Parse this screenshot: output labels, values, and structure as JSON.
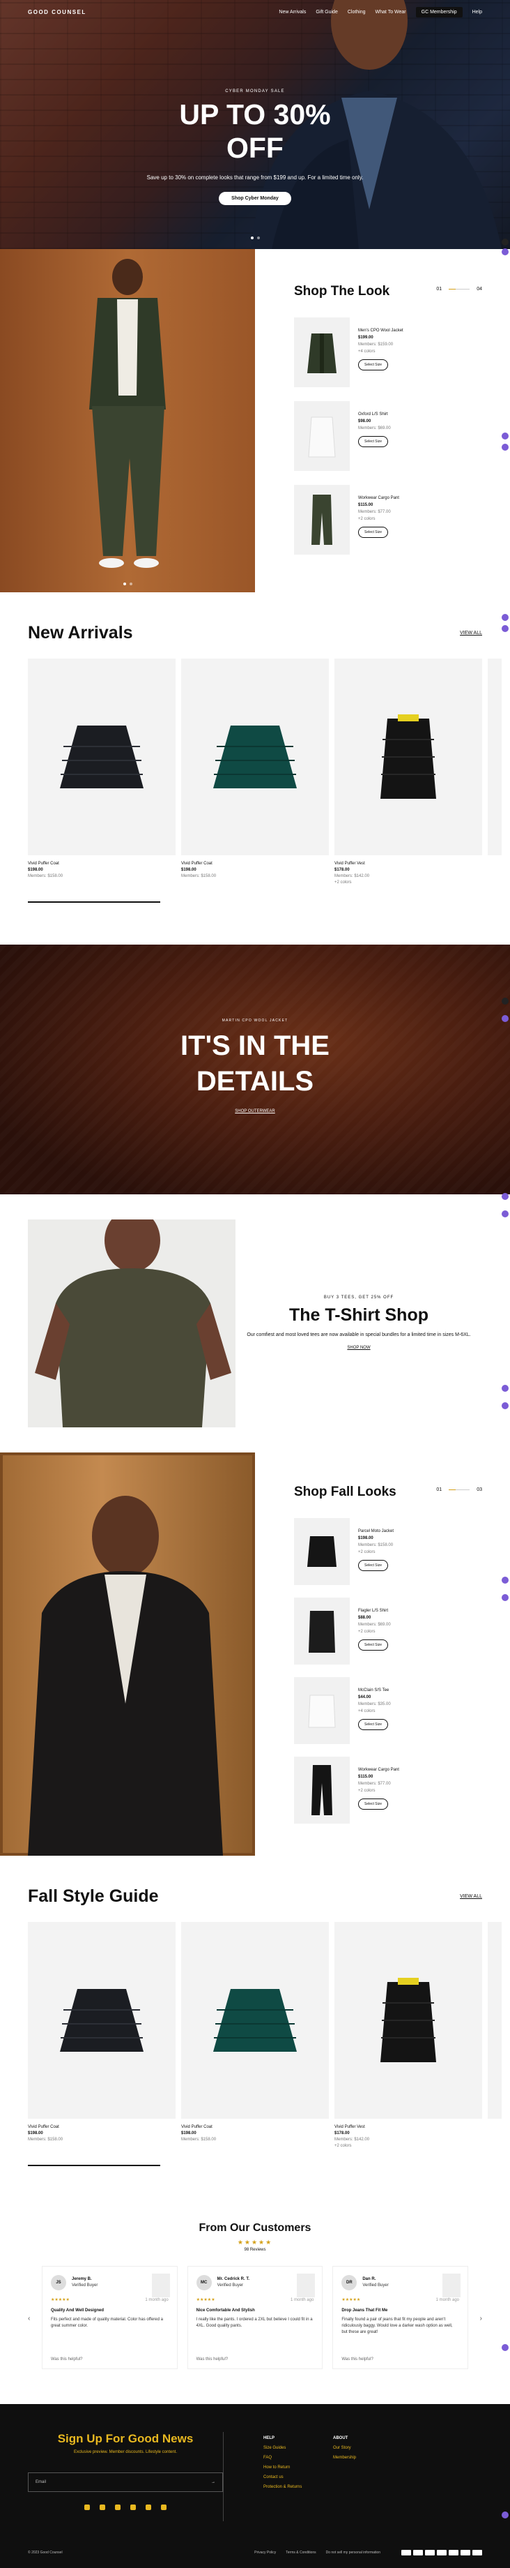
{
  "nav": {
    "logo": "GOOD COUNSEL",
    "links": [
      "New Arrivals",
      "Gift Guide",
      "Clothing",
      "What To Wear",
      "GC Membership",
      "Help"
    ]
  },
  "hero": {
    "eyebrow": "CYBER MONDAY SALE",
    "headline_line1": "UP TO 30%",
    "headline_line2": "OFF",
    "subtext": "Save up to 30% on complete looks that range from $199 and up. For a limited time only.",
    "cta": "Shop Cyber Monday"
  },
  "shop_the_look": {
    "title": "Shop The Look",
    "pager_current": "01",
    "pager_total": "04",
    "items": [
      {
        "name": "Men's CPO Wool Jacket",
        "price": "$199.00",
        "member": "Members: $159.00",
        "colors": "+4 colors",
        "button": "Select Size"
      },
      {
        "name": "Oxford L/S Shirt",
        "price": "$98.00",
        "member": "Members: $69.00",
        "colors": "",
        "button": "Select Size"
      },
      {
        "name": "Workwear Cargo Pant",
        "price": "$115.00",
        "member": "Members: $77.00",
        "colors": "+2 colors",
        "button": "Select Size"
      }
    ]
  },
  "new_arrivals": {
    "title": "New Arrivals",
    "view_all": "VIEW ALL",
    "products": [
      {
        "name": "Vivid Puffer Coat",
        "price": "$198.00",
        "member": "Members: $158.00"
      },
      {
        "name": "Vivid Puffer Coat",
        "price": "$198.00",
        "member": "Members: $158.00"
      },
      {
        "name": "Vivid Puffer Vest",
        "price": "$178.00",
        "member": "Members: $142.00",
        "colors": "+2 colors"
      }
    ]
  },
  "details": {
    "eyebrow": "MARTIN CPO WOOL JACKET",
    "line1": "IT'S IN THE",
    "line2": "DETAILS",
    "link": "SHOP OUTERWEAR"
  },
  "tshirt": {
    "eyebrow": "BUY 3 TEES, GET 25% OFF",
    "title": "The T-Shirt Shop",
    "body": "Our comfiest and most loved tees are now available in special bundles for a limited time in sizes M-6XL.",
    "link": "SHOP NOW"
  },
  "fall_looks": {
    "title": "Shop Fall Looks",
    "pager_current": "01",
    "pager_total": "03",
    "items": [
      {
        "name": "Parcel Moto Jacket",
        "price": "$198.00",
        "member": "Members: $158.00",
        "colors": "+2 colors",
        "button": "Select Size"
      },
      {
        "name": "Flagler L/S Shirt",
        "price": "$88.00",
        "member": "Members: $69.00",
        "colors": "+2 colors",
        "button": "Select Size"
      },
      {
        "name": "McClain S/S Tee",
        "price": "$44.00",
        "member": "Members: $35.00",
        "colors": "+4 colors",
        "button": "Select Size"
      },
      {
        "name": "Workwear Cargo Pant",
        "price": "$115.00",
        "member": "Members: $77.00",
        "colors": "+2 colors",
        "button": "Select Size"
      }
    ]
  },
  "fall_guide": {
    "title": "Fall Style Guide",
    "view_all": "VIEW ALL",
    "products": [
      {
        "name": "Vivid Puffer Coat",
        "price": "$198.00",
        "member": "Members: $158.00"
      },
      {
        "name": "Vivid Puffer Coat",
        "price": "$198.00",
        "member": "Members: $158.00"
      },
      {
        "name": "Vivid Puffer Vest",
        "price": "$178.00",
        "member": "Members: $142.00",
        "colors": "+2 colors"
      }
    ]
  },
  "reviews": {
    "title": "From Our Customers",
    "stars": "★★★★★",
    "count": "98 Reviews",
    "items": [
      {
        "initials": "JS",
        "name": "Jeremy B.",
        "badge": "Verified Buyer",
        "stars": "★★★★★",
        "time": "1 month ago",
        "title": "Quality And Well Designed",
        "body": "Fits perfect and made of quality material. Color has offered a great summer color.",
        "helpful": "Was this helpful?"
      },
      {
        "initials": "MC",
        "name": "Mr. Cedrick R. T.",
        "badge": "Verified Buyer",
        "stars": "★★★★★",
        "time": "1 month ago",
        "title": "Nice Comfortable And Stylish",
        "body": "I really like the pants. I ordered a 2XL but believe I could fit in a 4XL. Good quality pants.",
        "helpful": "Was this helpful?"
      },
      {
        "initials": "DR",
        "name": "Dan R.",
        "badge": "Verified Buyer",
        "stars": "★★★★★",
        "time": "1 month ago",
        "title": "Drop Jeans That Fit Me",
        "body": "Finally found a pair of jeans that fit my people and aren't ridiculously baggy. Would love a darker wash option as well, but these are great!",
        "helpful": "Was this helpful?"
      }
    ]
  },
  "footer": {
    "signup_title": "Sign Up For Good News",
    "signup_sub": "Exclusive preview. Member discounts. Lifestyle content.",
    "email_placeholder": "Email",
    "email_arrow": "→",
    "help_heading": "HELP",
    "help_links": [
      "Size Guides",
      "FAQ",
      "How to Return",
      "Contact us",
      "Protection & Returns"
    ],
    "about_heading": "ABOUT",
    "about_links": [
      "Our Story",
      "Membership"
    ],
    "copyright": "© 2023 Good Counsel",
    "bottom_links": [
      "Privacy Policy",
      "Terms & Conditions",
      "Do not sell my personal information"
    ]
  }
}
